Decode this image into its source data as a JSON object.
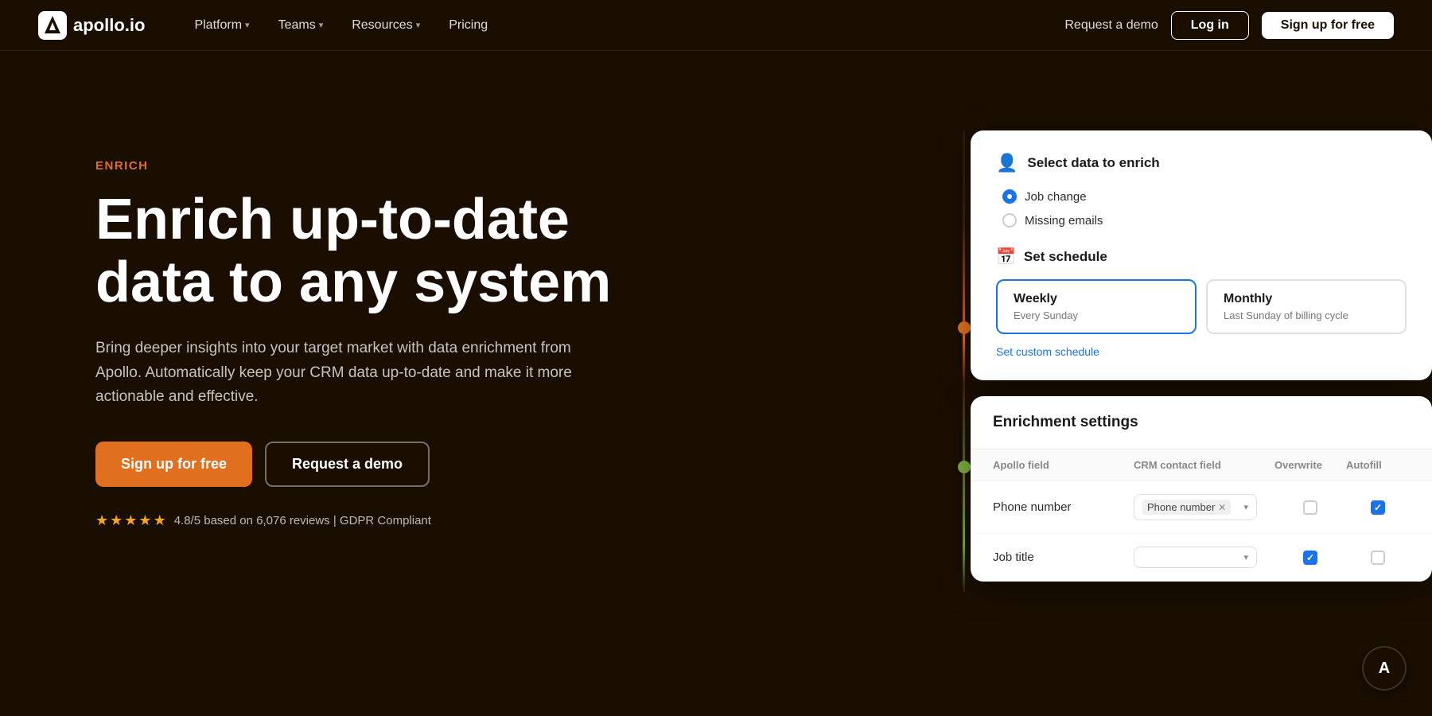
{
  "nav": {
    "logo_text": "apollo.io",
    "links": [
      {
        "label": "Platform",
        "has_chevron": true
      },
      {
        "label": "Teams",
        "has_chevron": true
      },
      {
        "label": "Resources",
        "has_chevron": true
      },
      {
        "label": "Pricing",
        "has_chevron": false
      }
    ],
    "request_demo": "Request a demo",
    "login": "Log in",
    "signup": "Sign up for free"
  },
  "hero": {
    "tag": "ENRICH",
    "title": "Enrich up-to-date\ndata to any system",
    "desc": "Bring deeper insights into your target market with data enrichment from Apollo. Automatically keep your CRM data up-to-date and make it more actionable and effective.",
    "signup_btn": "Sign up for free",
    "demo_btn": "Request a demo",
    "rating_text": "4.8/5 based on 6,076 reviews | GDPR Compliant"
  },
  "panel": {
    "select_card": {
      "title": "Select data to enrich",
      "options": [
        {
          "label": "Job change",
          "selected": true
        },
        {
          "label": "Missing emails",
          "selected": false
        }
      ]
    },
    "schedule_card": {
      "title": "Set schedule",
      "options": [
        {
          "label": "Weekly",
          "sub": "Every Sunday",
          "active": true
        },
        {
          "label": "Monthly",
          "sub": "Last Sunday of billing cycle",
          "active": false
        }
      ],
      "custom_link": "Set custom schedule"
    },
    "enrichment_card": {
      "title": "Enrichment settings",
      "columns": [
        "Apollo field",
        "CRM contact field",
        "Overwrite",
        "Autofill"
      ],
      "rows": [
        {
          "field": "Phone number",
          "crm_value": "Phone number",
          "overwrite": false,
          "autofill": true
        },
        {
          "field": "Job title",
          "crm_value": "",
          "overwrite": true,
          "autofill": false
        }
      ]
    }
  },
  "fab": {
    "icon": "A"
  }
}
